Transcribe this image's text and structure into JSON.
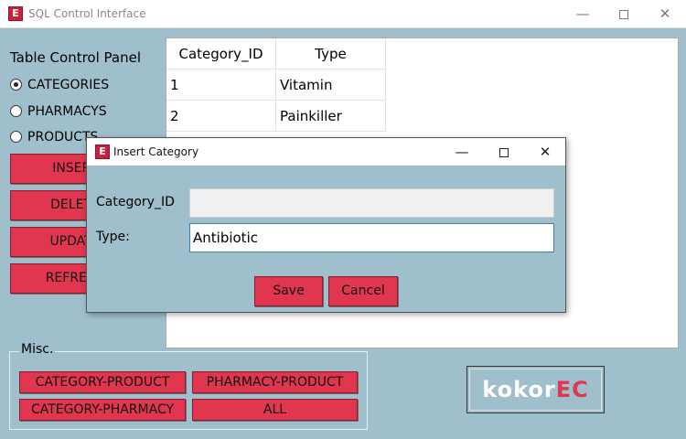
{
  "window": {
    "icon_letter": "E",
    "title": "SQL Control Interface",
    "minimize_glyph": "—",
    "close_glyph": "✕"
  },
  "sidebar": {
    "title": "Table Control Panel",
    "radios": [
      {
        "label": "CATEGORIES",
        "selected": true
      },
      {
        "label": "PHARMACYS",
        "selected": false
      },
      {
        "label": "PRODUCTS",
        "selected": false
      }
    ],
    "buttons": [
      {
        "label": "INSERT"
      },
      {
        "label": "DELETE"
      },
      {
        "label": "UPDATE"
      },
      {
        "label": "REFRESH"
      }
    ]
  },
  "table": {
    "headers": [
      "Category_ID",
      "Type"
    ],
    "rows": [
      [
        "1",
        "Vitamin"
      ],
      [
        "2",
        "Painkiller"
      ]
    ]
  },
  "misc": {
    "label": "Misc.",
    "buttons": [
      "CATEGORY-PRODUCT",
      "PHARMACY-PRODUCT",
      "CATEGORY-PHARMACY",
      "ALL"
    ]
  },
  "logo": {
    "part1": "kokor",
    "part2": "EC",
    "accent": "#e0364f"
  },
  "dialog": {
    "icon_letter": "E",
    "title": "Insert Category",
    "minimize_glyph": "—",
    "close_glyph": "✕",
    "fields": [
      {
        "label": "Category_ID",
        "value": "",
        "disabled": true
      },
      {
        "label": "Type:",
        "value": "Antibiotic",
        "disabled": false
      }
    ],
    "save_label": "Save",
    "cancel_label": "Cancel"
  },
  "colors": {
    "background": "#9fbfcc",
    "button": "#e0364f",
    "button_border": "#8a1d2e"
  }
}
